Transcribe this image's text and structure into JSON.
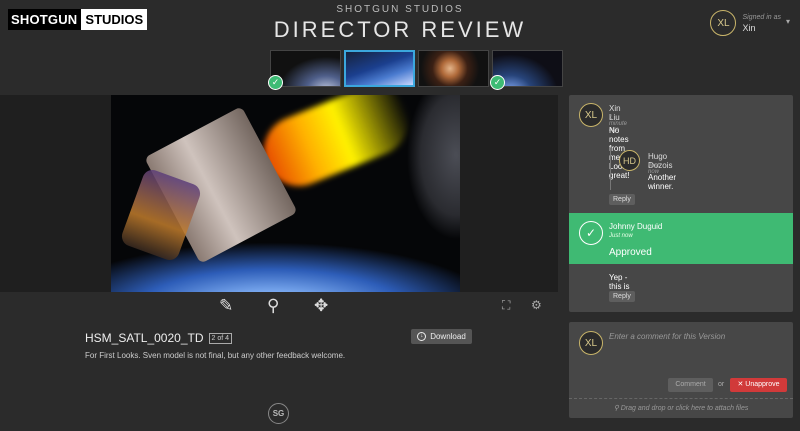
{
  "header": {
    "logo_left": "SHOTGUN",
    "logo_right": "STUDIOS",
    "studio": "SHOTGUN STUDIOS",
    "title": "DIRECTOR REVIEW"
  },
  "user": {
    "initials": "XL",
    "signed_in_label": "Signed in as",
    "name": "Xin"
  },
  "thumbnails": [
    {
      "approved": true,
      "selected": false
    },
    {
      "approved": false,
      "selected": true
    },
    {
      "approved": false,
      "selected": false
    },
    {
      "approved": true,
      "selected": false
    }
  ],
  "icons": {
    "check": "✓",
    "pen": "✎",
    "zoom": "⚲",
    "move": "✥",
    "fullscreen": "⛶",
    "settings": "⚙",
    "caret": "▾",
    "download": "↓",
    "close": "✕",
    "paperclip": "⚲"
  },
  "version": {
    "name": "HSM_SATL_0020_TD",
    "position": "2 of 4",
    "download_label": "Download",
    "description": "For First Looks. Sven model is not final, but any other feedback welcome."
  },
  "footer_logo": "SG",
  "comments": [
    {
      "initials": "XL",
      "name": "Xin Liu",
      "time": "1 minute ago",
      "text": "No notes from me. Looks great!"
    },
    {
      "initials": "HD",
      "name": "Hugo Dozois",
      "time": "Just now",
      "text": "Another winner."
    },
    {
      "name": "Johnny Duguid",
      "time": "Just now",
      "status": "Approved",
      "text": "Yep - this is great!"
    }
  ],
  "reply_label": "Reply",
  "entry": {
    "initials": "XL",
    "placeholder": "Enter a comment for this Version",
    "comment_label": "Comment",
    "or_label": "or",
    "unapprove_label": "Unapprove",
    "drop_label": "Drag and drop or click here to attach files"
  },
  "colors": {
    "accent": "#3ba7dd",
    "approved": "#3fba73",
    "unapprove": "#d13a3a"
  }
}
